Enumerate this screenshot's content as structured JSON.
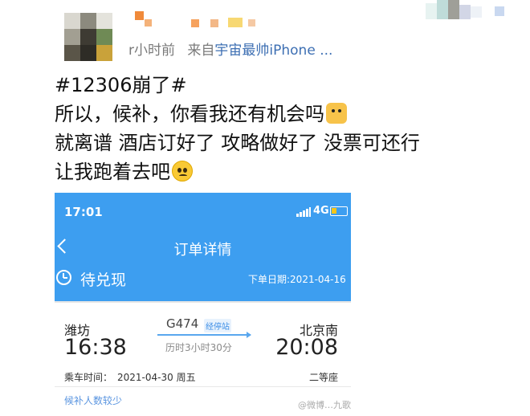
{
  "header": {
    "time_ago": "r小时前",
    "from_prefix": "来自",
    "source": "宇宙最帅iPhone ..."
  },
  "post": {
    "line1": "#12306崩了#",
    "line2": "所以，候补，你看我还有机会吗",
    "line3": "就离谱 酒店订好了 攻略做好了 没票可还行",
    "line4": "让我跑着去吧",
    "icons": [
      "cat-emoji",
      "sad-face-emoji"
    ]
  },
  "screenshot": {
    "status_time": "17:01",
    "network": "4G",
    "nav_title": "订单详情",
    "order_status": "待兑现",
    "order_date": "下单日期:2021-04-16",
    "from_city": "潍坊",
    "to_city": "北京南",
    "train_no": "G474",
    "stops_link": "经停站",
    "duration": "历时3小时30分",
    "depart_time": "16:38",
    "arrive_time": "20:08",
    "ride_time_label": "乘车时间：",
    "ride_date": "2021-04-30 周五",
    "seat_class": "二等座",
    "waitlist_hint": "候补人数较少"
  },
  "watermark": "@微博…九歌",
  "colors": {
    "app_blue": "#3d9ef0",
    "link_blue": "#3d6fb3",
    "muted_gray": "#7a7a7a"
  }
}
